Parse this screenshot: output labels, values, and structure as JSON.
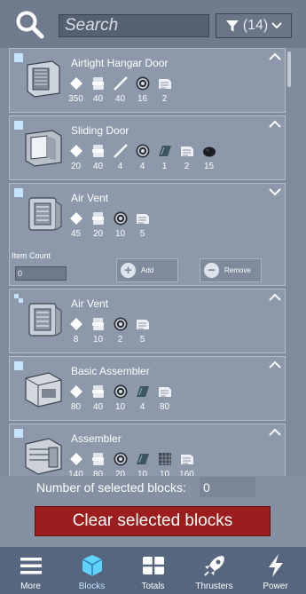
{
  "search": {
    "placeholder": "Search"
  },
  "filter": {
    "count_label": "(14)"
  },
  "blocks": [
    {
      "name": "Airtight Hangar Door",
      "selected": true,
      "expanded": false,
      "resources": [
        {
          "icon": "plate-icon",
          "amount": "350"
        },
        {
          "icon": "component-icon",
          "amount": "40"
        },
        {
          "icon": "pipe-icon",
          "amount": "40"
        },
        {
          "icon": "motor-icon",
          "amount": "16"
        },
        {
          "icon": "computer-icon",
          "amount": "2"
        }
      ]
    },
    {
      "name": "Sliding Door",
      "selected": true,
      "expanded": false,
      "resources": [
        {
          "icon": "plate-icon",
          "amount": "20"
        },
        {
          "icon": "component-icon",
          "amount": "40"
        },
        {
          "icon": "pipe-icon",
          "amount": "4"
        },
        {
          "icon": "motor-icon",
          "amount": "4"
        },
        {
          "icon": "glass-icon",
          "amount": "1"
        },
        {
          "icon": "computer-icon",
          "amount": "2"
        },
        {
          "icon": "gravel-icon",
          "amount": "15"
        }
      ]
    },
    {
      "name": "Air Vent",
      "selected": true,
      "expanded": true,
      "resources": [
        {
          "icon": "plate-icon",
          "amount": "45"
        },
        {
          "icon": "component-icon",
          "amount": "20"
        },
        {
          "icon": "motor-icon",
          "amount": "10"
        },
        {
          "icon": "computer-icon",
          "amount": "5"
        }
      ],
      "item_count_label": "Item Count",
      "item_count_value": "0",
      "add_label": "Add",
      "remove_label": "Remove"
    },
    {
      "name": "Air Vent",
      "selected": "partial",
      "expanded": false,
      "resources": [
        {
          "icon": "plate-icon",
          "amount": "8"
        },
        {
          "icon": "component-icon",
          "amount": "10"
        },
        {
          "icon": "motor-icon",
          "amount": "2"
        },
        {
          "icon": "computer-icon",
          "amount": "5"
        }
      ]
    },
    {
      "name": "Basic Assembler",
      "selected": true,
      "expanded": false,
      "resources": [
        {
          "icon": "plate-icon",
          "amount": "80"
        },
        {
          "icon": "component-icon",
          "amount": "40"
        },
        {
          "icon": "motor-icon",
          "amount": "10"
        },
        {
          "icon": "glass-icon",
          "amount": "4"
        },
        {
          "icon": "computer-icon",
          "amount": "80"
        }
      ]
    },
    {
      "name": "Assembler",
      "selected": true,
      "expanded": false,
      "resources": [
        {
          "icon": "plate-icon",
          "amount": "140"
        },
        {
          "icon": "component-icon",
          "amount": "80"
        },
        {
          "icon": "motor-icon",
          "amount": "20"
        },
        {
          "icon": "glass-icon",
          "amount": "10"
        },
        {
          "icon": "grid-icon",
          "amount": "10"
        },
        {
          "icon": "computer-icon",
          "amount": "160"
        }
      ]
    }
  ],
  "selection": {
    "label": "Number of selected blocks:",
    "value": "0"
  },
  "clear_button": {
    "label": "Clear selected blocks"
  },
  "nav": [
    {
      "label": "More",
      "icon": "menu-icon",
      "active": false
    },
    {
      "label": "Blocks",
      "icon": "cube-icon",
      "active": true
    },
    {
      "label": "Totals",
      "icon": "table-icon",
      "active": false
    },
    {
      "label": "Thrusters",
      "icon": "rocket-icon",
      "active": false
    },
    {
      "label": "Power",
      "icon": "lightning-icon",
      "active": false
    }
  ],
  "colors": {
    "accent": "#5fd2ff",
    "clear_red": "#9b1d1d",
    "nav_bg": "#57667f",
    "selection_blue": "#c7e4ff"
  }
}
